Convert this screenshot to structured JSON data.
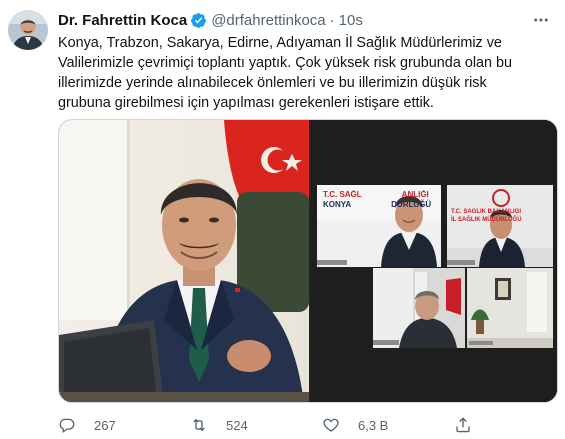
{
  "author": {
    "name": "Dr. Fahrettin Koca",
    "handle": "@drfahrettinkoca",
    "separator": "·",
    "time": "10s",
    "verified": true
  },
  "tweet_text": [
    "Konya, Trabzon, Sakarya, Edirne, Adıyaman İl Sağlık Müdürlerimiz ve",
    "Valilerimizle çevrimiçi toplantı yaptık. Çok yüksek risk grubunda olan bu",
    "illerimizde yerinde alınabilecek önlemleri ve bu illerimizin düşük risk",
    "grubuna girebilmesi için yapılması gerekenleri istişare ettik."
  ],
  "media": {
    "video_call": {
      "tiles": [
        {
          "banner_line1": "T.C. SAĞL",
          "banner_line1b": "ANLIĞI",
          "banner_line2": "KONYA",
          "banner_line2b": "DÜRLÜĞÜ"
        },
        {
          "banner_line1": "T.C. SAĞLIK BAKANLIĞI",
          "banner_line2": "İL SAĞLIK MÜDÜRLÜĞÜ"
        },
        {},
        {}
      ]
    }
  },
  "actions": {
    "reply_count": "267",
    "retweet_count": "524",
    "like_count": "6,3 B"
  },
  "colors": {
    "accent": "#1d9bf0",
    "muted": "#536471",
    "text": "#0f1419"
  }
}
